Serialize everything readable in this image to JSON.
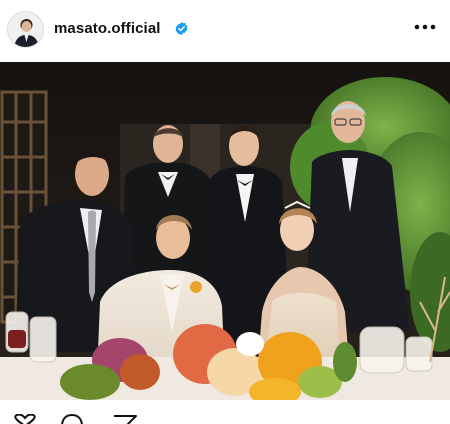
{
  "post": {
    "username": "masato.official",
    "verified": true,
    "more_icon": "more-horizontal-icon",
    "image_alt": ""
  },
  "colors": {
    "text": "#111111",
    "verified_blue": "#1d9bf0",
    "background": "#ffffff"
  },
  "actions": {
    "like_icon": "heart-icon",
    "comment_icon": "comment-icon",
    "share_icon": "send-icon"
  }
}
